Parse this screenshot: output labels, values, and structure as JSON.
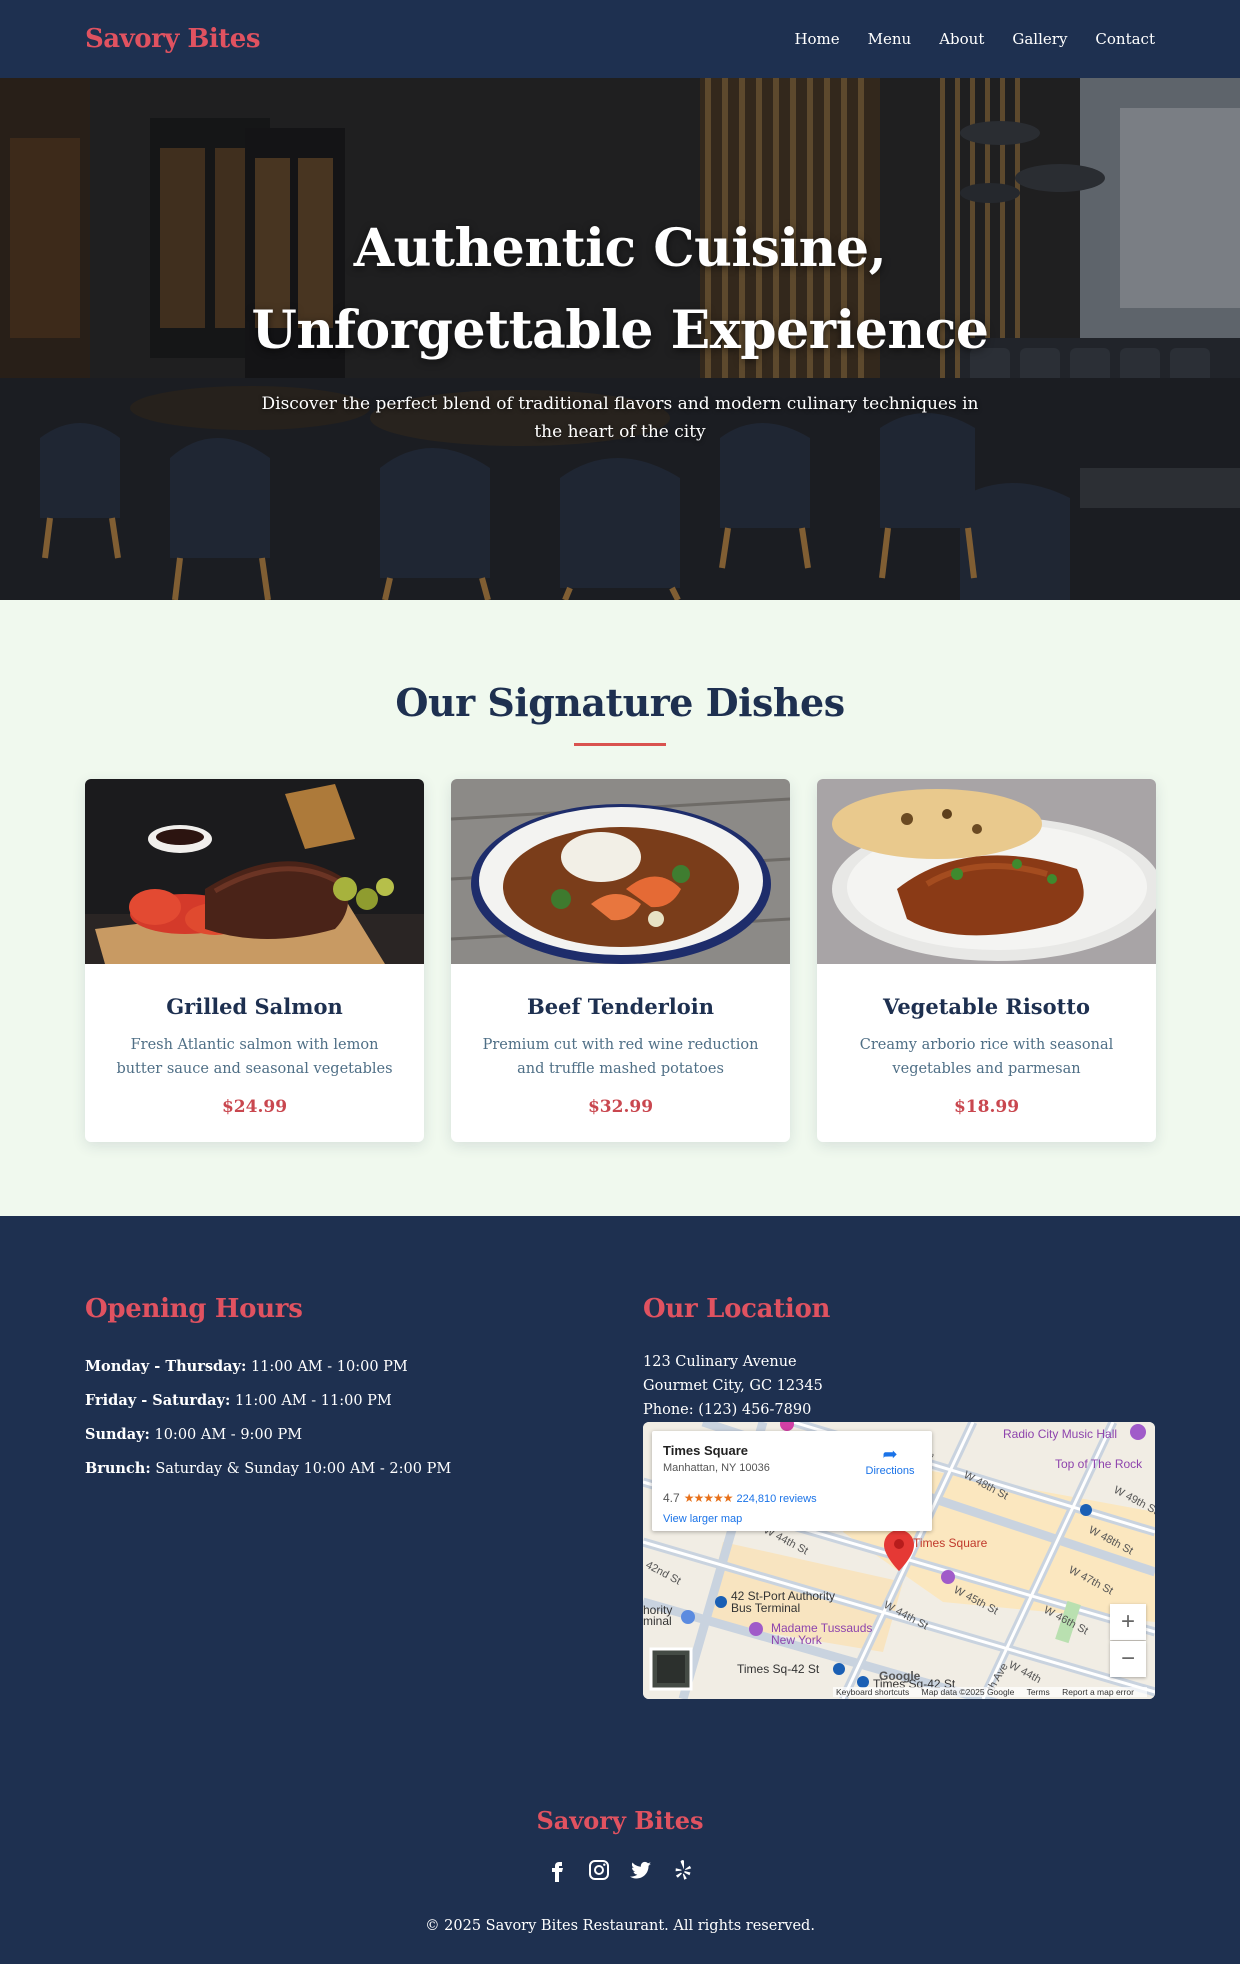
{
  "nav": {
    "brand": "Savory Bites",
    "links": [
      "Home",
      "Menu",
      "About",
      "Gallery",
      "Contact"
    ]
  },
  "hero": {
    "title_line1": "Authentic Cuisine,",
    "title_line2": "Unforgettable Experience",
    "subtitle": "Discover the perfect blend of traditional flavors and modern culinary techniques in the heart of the city"
  },
  "dishes": {
    "title": "Our Signature Dishes",
    "items": [
      {
        "name": "Grilled Salmon",
        "description": "Fresh Atlantic salmon with lemon butter sauce and seasonal vegetables",
        "price": "$24.99"
      },
      {
        "name": "Beef Tenderloin",
        "description": "Premium cut with red wine reduction and truffle mashed potatoes",
        "price": "$32.99"
      },
      {
        "name": "Vegetable Risotto",
        "description": "Creamy arborio rice with seasonal vegetables and parmesan",
        "price": "$18.99"
      }
    ]
  },
  "hours": {
    "title": "Opening Hours",
    "rows": [
      {
        "days": "Monday - Thursday:",
        "time": "11:00 AM - 10:00 PM"
      },
      {
        "days": "Friday - Saturday:",
        "time": "11:00 AM - 11:00 PM"
      },
      {
        "days": "Sunday:",
        "time": "10:00 AM - 9:00 PM"
      },
      {
        "days": "Brunch:",
        "time": "Saturday & Sunday 10:00 AM - 2:00 PM"
      }
    ]
  },
  "location": {
    "title": "Our Location",
    "address_line1": "123 Culinary Avenue",
    "address_line2": "Gourmet City, GC 12345",
    "phone": "Phone: (123) 456-7890",
    "map": {
      "place": "Times Square",
      "place_address": "Manhattan, NY 10036",
      "rating": "4.7",
      "stars": "★★★★★",
      "reviews": "224,810 reviews",
      "view_larger": "View larger map",
      "directions": "Directions",
      "zoom_in": "+",
      "zoom_out": "−",
      "labels": {
        "radio_city": "Radio City Music Hall",
        "top_of_rock": "Top of The Rock",
        "times_square": "Times Square",
        "port_authority_1": "42 St-Port Authority",
        "port_authority_2": "Bus Terminal",
        "tussauds_1": "Madame Tussauds",
        "tussauds_2": "New York",
        "ts_42": "Times Sq-42 St",
        "ts_42b": "Times Sq-42 St",
        "w48": "W 48th St",
        "w49": "W 49th St",
        "w48b": "W 48th St",
        "w47": "W 47th St",
        "w46": "W 46th St",
        "w45": "W 45th St",
        "w44": "W 44th St",
        "w44b": "W 44th St",
        "w44c": "W 44th",
        "w42": "42nd St",
        "ave": "Ave",
        "ave2": "th Ave",
        "hority": "hority",
        "minal": "minal",
        "google": "Google"
      },
      "footer": {
        "shortcuts": "Keyboard shortcuts",
        "mapdata": "Map data ©2025 Google",
        "terms": "Terms",
        "report": "Report a map error"
      }
    }
  },
  "footer": {
    "brand": "Savory Bites",
    "social_icons": [
      "facebook-icon",
      "instagram-icon",
      "twitter-icon",
      "yelp-icon"
    ],
    "copyright": "© 2025 Savory Bites Restaurant. All rights reserved."
  },
  "colors": {
    "navy": "#1e3050",
    "accent": "#e05260",
    "price": "#c9474f",
    "mint": "#f0f9ee"
  }
}
